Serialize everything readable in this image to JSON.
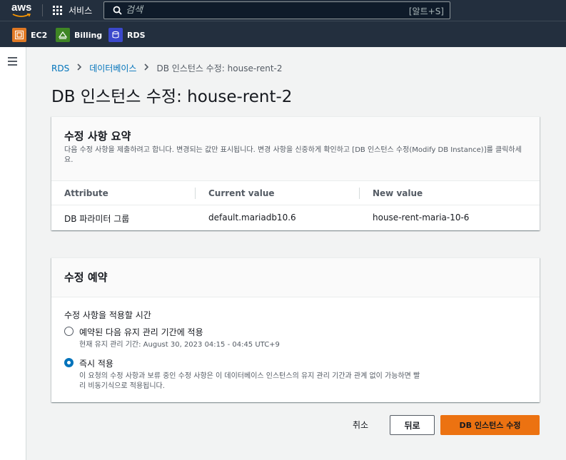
{
  "topnav": {
    "logo": "aws",
    "services_label": "서비스",
    "search_placeholder": "검색",
    "search_shortcut": "[알트+S]"
  },
  "favorites": [
    {
      "label": "EC2",
      "icon": "ec2-icon",
      "color": "#e07924"
    },
    {
      "label": "Billing",
      "icon": "billing-icon",
      "color": "#3f8624"
    },
    {
      "label": "RDS",
      "icon": "rds-icon",
      "color": "#3b48cc"
    }
  ],
  "breadcrumb": {
    "items": [
      "RDS",
      "데이터베이스"
    ],
    "current": "DB 인스턴스 수정: house-rent-2"
  },
  "page_title": "DB 인스턴스 수정: house-rent-2",
  "summary": {
    "title": "수정 사항 요약",
    "description": "다음 수정 사항을 제출하려고 합니다. 변경되는 값만 표시됩니다. 변경 사항을 신중하게 확인하고 [DB 인스턴스 수정(Modify DB Instance)]를 클릭하세요.",
    "columns": [
      "Attribute",
      "Current value",
      "New value"
    ],
    "rows": [
      [
        "DB 파라미터 그룹",
        "default.mariadb10.6",
        "house-rent-maria-10-6"
      ]
    ]
  },
  "schedule": {
    "title": "수정 예약",
    "label": "수정 사항을 적용할 시간",
    "options": [
      {
        "label": "예약된 다음 유지 관리 기간에 적용",
        "description": "현재 유지 관리 기간: August 30, 2023 04:15 - 04:45 UTC+9",
        "checked": false
      },
      {
        "label": "즉시 적용",
        "description": "이 요청의 수정 사항과 보류 중인 수정 사항은 이 데이터베이스 인스턴스의 유지 관리 기간과 관계 없이 가능하면 빨리 비동기식으로 적용됩니다.",
        "checked": true
      }
    ]
  },
  "actions": {
    "cancel": "취소",
    "back": "뒤로",
    "submit": "DB 인스턴스 수정"
  },
  "colors": {
    "nav_bg": "#232f3e",
    "link": "#0073bb",
    "primary": "#ec7211"
  }
}
